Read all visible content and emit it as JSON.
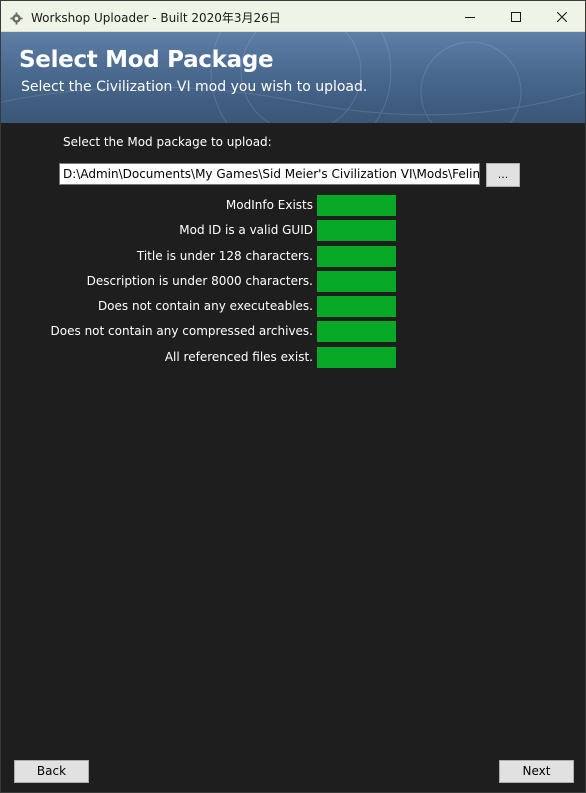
{
  "window": {
    "title": "Workshop Uploader - Built 2020年3月26日",
    "app_icon": "gear-icon",
    "controls": [
      "minimize-icon",
      "maximize-icon",
      "close-icon"
    ]
  },
  "header": {
    "title": "Select Mod Package",
    "subtitle": "Select the Civilization VI mod you wish to upload."
  },
  "package": {
    "label": "Select the Mod package to upload:",
    "path": "D:\\Admin\\Documents\\My Games\\Sid Meier's Civilization VI\\Mods\\Feline",
    "browse_label": "..."
  },
  "checks": [
    {
      "label": "ModInfo Exists",
      "status": "pass"
    },
    {
      "label": "Mod ID is a valid GUID",
      "status": "pass"
    },
    {
      "label": "Title is under 128 characters.",
      "status": "pass"
    },
    {
      "label": "Description is under 8000 characters.",
      "status": "pass"
    },
    {
      "label": "Does not contain any executeables.",
      "status": "pass"
    },
    {
      "label": "Does not contain any compressed archives.",
      "status": "pass"
    },
    {
      "label": "All referenced files exist.",
      "status": "pass"
    }
  ],
  "footer": {
    "back_label": "Back",
    "next_label": "Next"
  },
  "colors": {
    "pass": "#06a826",
    "background": "#1e1e1e",
    "header": "#49698f"
  }
}
